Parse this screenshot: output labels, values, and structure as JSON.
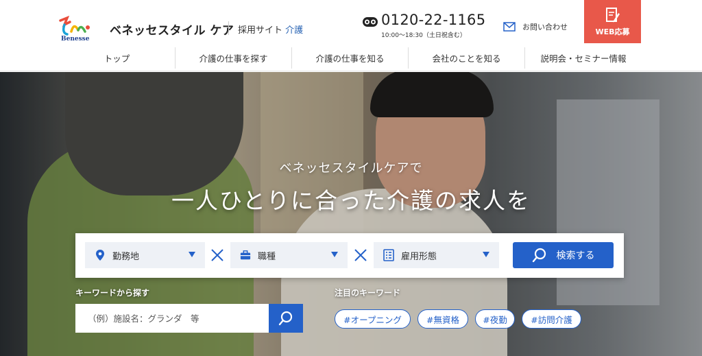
{
  "header": {
    "logo_sub": "Benesse",
    "brand": "ベネッセスタイル ケア",
    "site_label": "採用サイト",
    "site_accent": "介護",
    "phone": "0120-22-1165",
    "phone_hours": "10:00～18:30（土日祝含む）",
    "contact_label": "お問い合わせ",
    "apply_label": "WEB応募"
  },
  "nav": {
    "items": [
      "トップ",
      "介護の仕事を探す",
      "介護の仕事を知る",
      "会社のことを知る",
      "説明会・セミナー情報"
    ]
  },
  "hero": {
    "subtitle": "ベネッセスタイルケアで",
    "title": "一人ひとりに合った介護の求人を"
  },
  "search": {
    "location_label": "勤務地",
    "job_label": "職種",
    "employment_label": "雇用形態",
    "button_label": "検索する"
  },
  "keyword": {
    "title": "キーワードから探す",
    "placeholder": "（例）施設名：グランダ　等"
  },
  "featured": {
    "title": "注目のキーワード",
    "tags": [
      "#オープニング",
      "#無資格",
      "#夜勤",
      "#訪問介護"
    ]
  },
  "colors": {
    "accent_blue": "#2461c9",
    "apply_red": "#e8584a",
    "site_accent": "#2c66b5"
  }
}
